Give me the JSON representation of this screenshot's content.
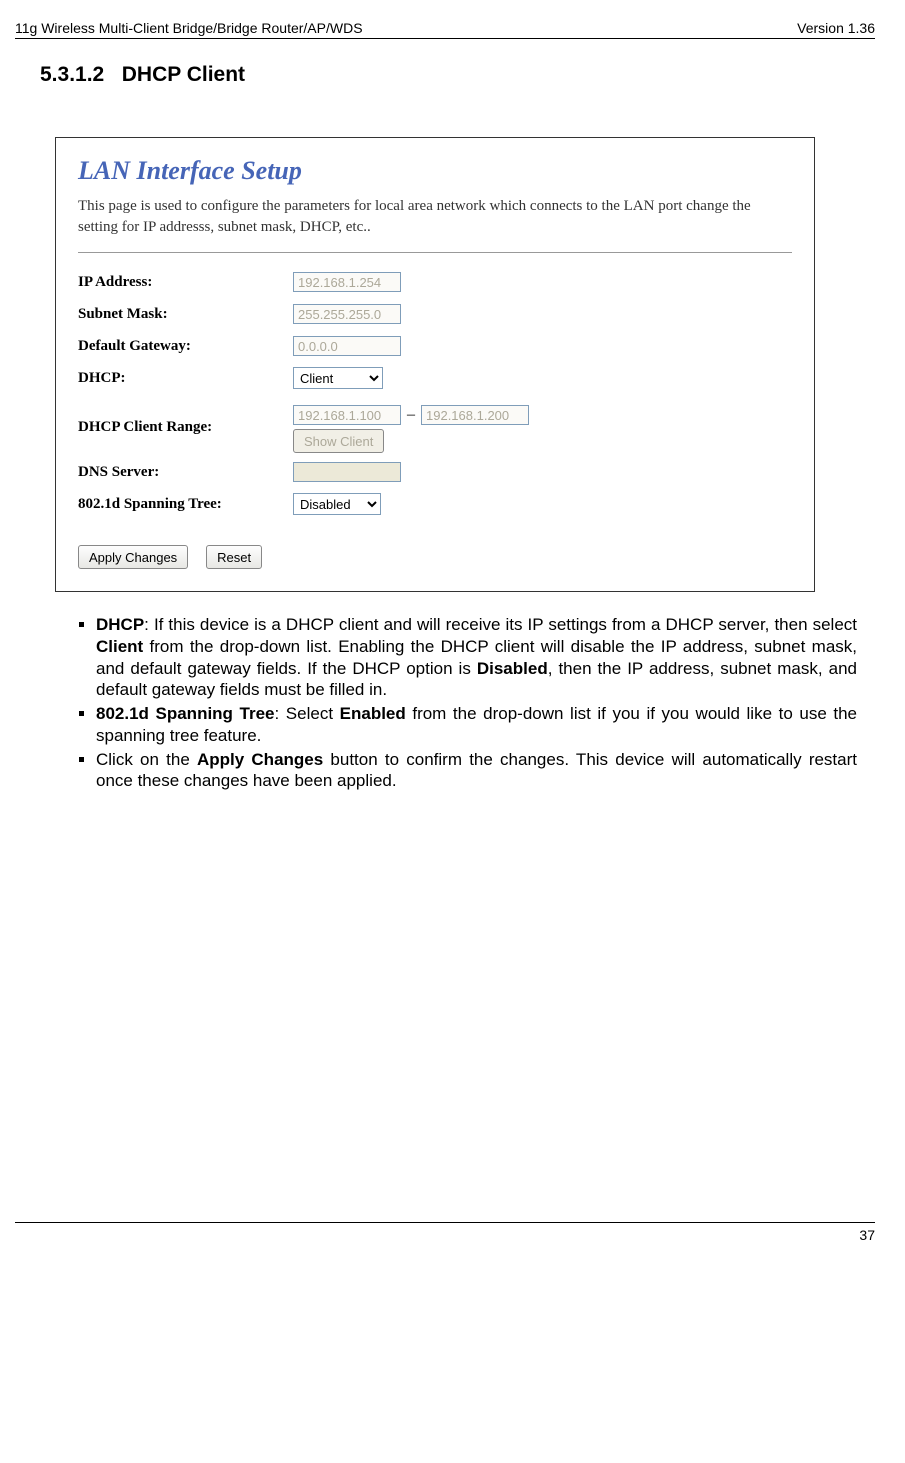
{
  "header": {
    "left": "11g Wireless Multi-Client Bridge/Bridge Router/AP/WDS",
    "right": "Version 1.36"
  },
  "section_number": "5.3.1.2",
  "section_title": "DHCP Client",
  "screenshot": {
    "title": "LAN Interface Setup",
    "desc": "This page is used to configure the parameters for local area network which connects to the LAN port change the setting for IP addresss, subnet mask, DHCP, etc..",
    "labels": {
      "ip": "IP Address:",
      "mask": "Subnet Mask:",
      "gw": "Default Gateway:",
      "dhcp": "DHCP:",
      "range": "DHCP Client Range:",
      "dns": "DNS Server:",
      "span": "802.1d Spanning Tree:"
    },
    "values": {
      "ip": "192.168.1.254",
      "mask": "255.255.255.0",
      "gw": "0.0.0.0",
      "dhcp": "Client",
      "range_start": "192.168.1.100",
      "range_end": "192.168.1.200",
      "show_client": "Show Client",
      "dns": "",
      "span": "Disabled"
    },
    "buttons": {
      "apply": "Apply Changes",
      "reset": "Reset"
    }
  },
  "bullets": {
    "b1_strong": "DHCP",
    "b1_a": ": If this device is a DHCP client and will receive its IP settings from a DHCP server, then select ",
    "b1_client": "Client",
    "b1_b": " from the drop-down list. Enabling the DHCP client will disable the IP address, subnet mask, and default gateway fields. If the DHCP option is ",
    "b1_disabled": "Disabled",
    "b1_c": ", then the IP address, subnet mask, and default gateway fields must be filled in.",
    "b2_strong": "802.1d Spanning Tree",
    "b2_a": ": Select ",
    "b2_enabled": "Enabled",
    "b2_b": " from the drop-down list if you if you would like to use the spanning tree feature.",
    "b3_a": "Click on the ",
    "b3_apply": "Apply Changes",
    "b3_b": " button to confirm the changes. This device will automatically restart once these changes have been applied."
  },
  "page_number": "37"
}
